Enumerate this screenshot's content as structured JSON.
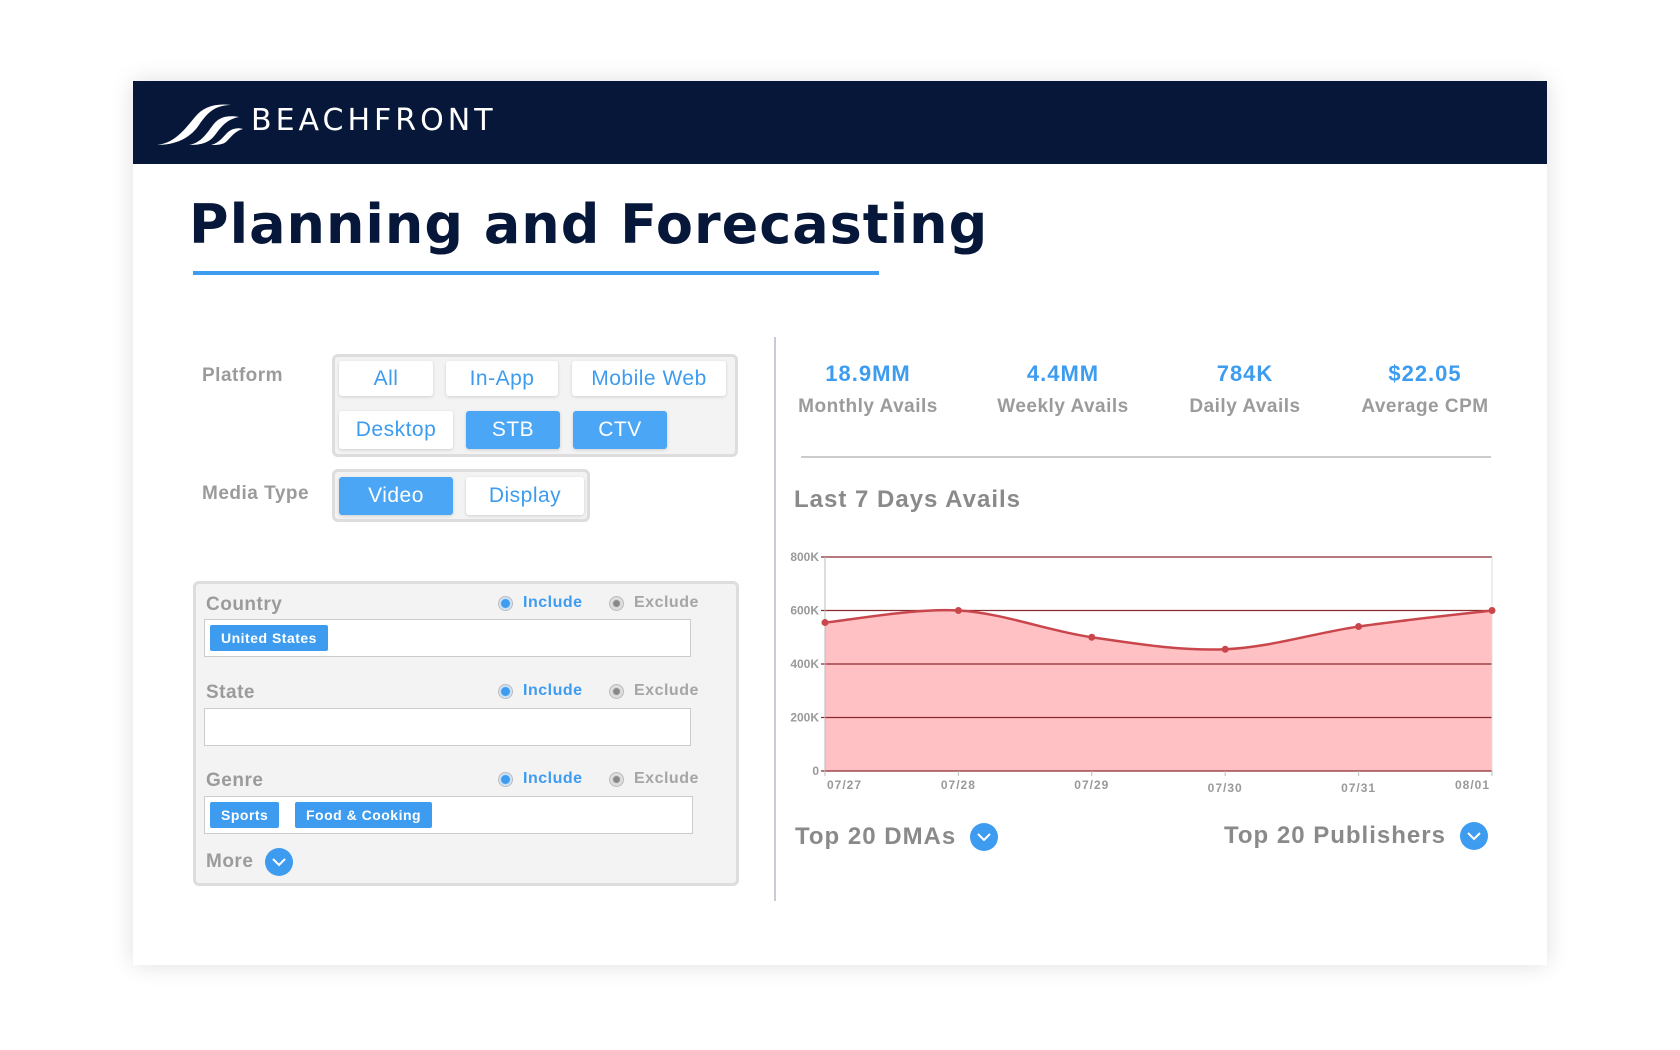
{
  "brand": {
    "name": "BEACHFRONT"
  },
  "page": {
    "title": "Planning and Forecasting"
  },
  "platform": {
    "label": "Platform",
    "options": [
      {
        "label": "All",
        "selected": false
      },
      {
        "label": "In-App",
        "selected": false
      },
      {
        "label": "Mobile Web",
        "selected": false
      },
      {
        "label": "Desktop",
        "selected": false
      },
      {
        "label": "STB",
        "selected": true
      },
      {
        "label": "CTV",
        "selected": true
      }
    ]
  },
  "media_type": {
    "label": "Media Type",
    "options": [
      {
        "label": "Video",
        "selected": true
      },
      {
        "label": "Display",
        "selected": false
      }
    ]
  },
  "filters": {
    "include_label": "Include",
    "exclude_label": "Exclude",
    "country": {
      "label": "Country",
      "mode": "Include",
      "tags": [
        "United States"
      ]
    },
    "state": {
      "label": "State",
      "mode": "Include",
      "tags": []
    },
    "genre": {
      "label": "Genre",
      "mode": "Include",
      "tags": [
        "Sports",
        "Food & Cooking"
      ]
    },
    "more_label": "More"
  },
  "stats": [
    {
      "value": "18.9MM",
      "label": "Monthly Avails"
    },
    {
      "value": "4.4MM",
      "label": "Weekly Avails"
    },
    {
      "value": "784K",
      "label": "Daily Avails"
    },
    {
      "value": "$22.05",
      "label": "Average CPM"
    }
  ],
  "chart_title": "Last 7 Days Avails",
  "chart_data": {
    "type": "area",
    "title": "Last 7 Days Avails",
    "categories": [
      "07/27",
      "07/28",
      "07/29",
      "07/30",
      "07/31",
      "08/01"
    ],
    "values": [
      555000,
      600000,
      500000,
      455000,
      540000,
      600000
    ],
    "ylim": [
      0,
      800000
    ],
    "yticks": [
      {
        "v": 0,
        "label": "0"
      },
      {
        "v": 200000,
        "label": "200K"
      },
      {
        "v": 400000,
        "label": "400K"
      },
      {
        "v": 600000,
        "label": "600K"
      },
      {
        "v": 800000,
        "label": "800K"
      }
    ],
    "grid": true,
    "colors": {
      "line": "#c9474c",
      "fill": "#ffc1c3",
      "grid": "#8b2b30"
    }
  },
  "sections": {
    "dmas": "Top 20 DMAs",
    "publishers": "Top 20 Publishers"
  },
  "colors": {
    "navy": "#06173a",
    "accent": "#3d9cf0"
  }
}
